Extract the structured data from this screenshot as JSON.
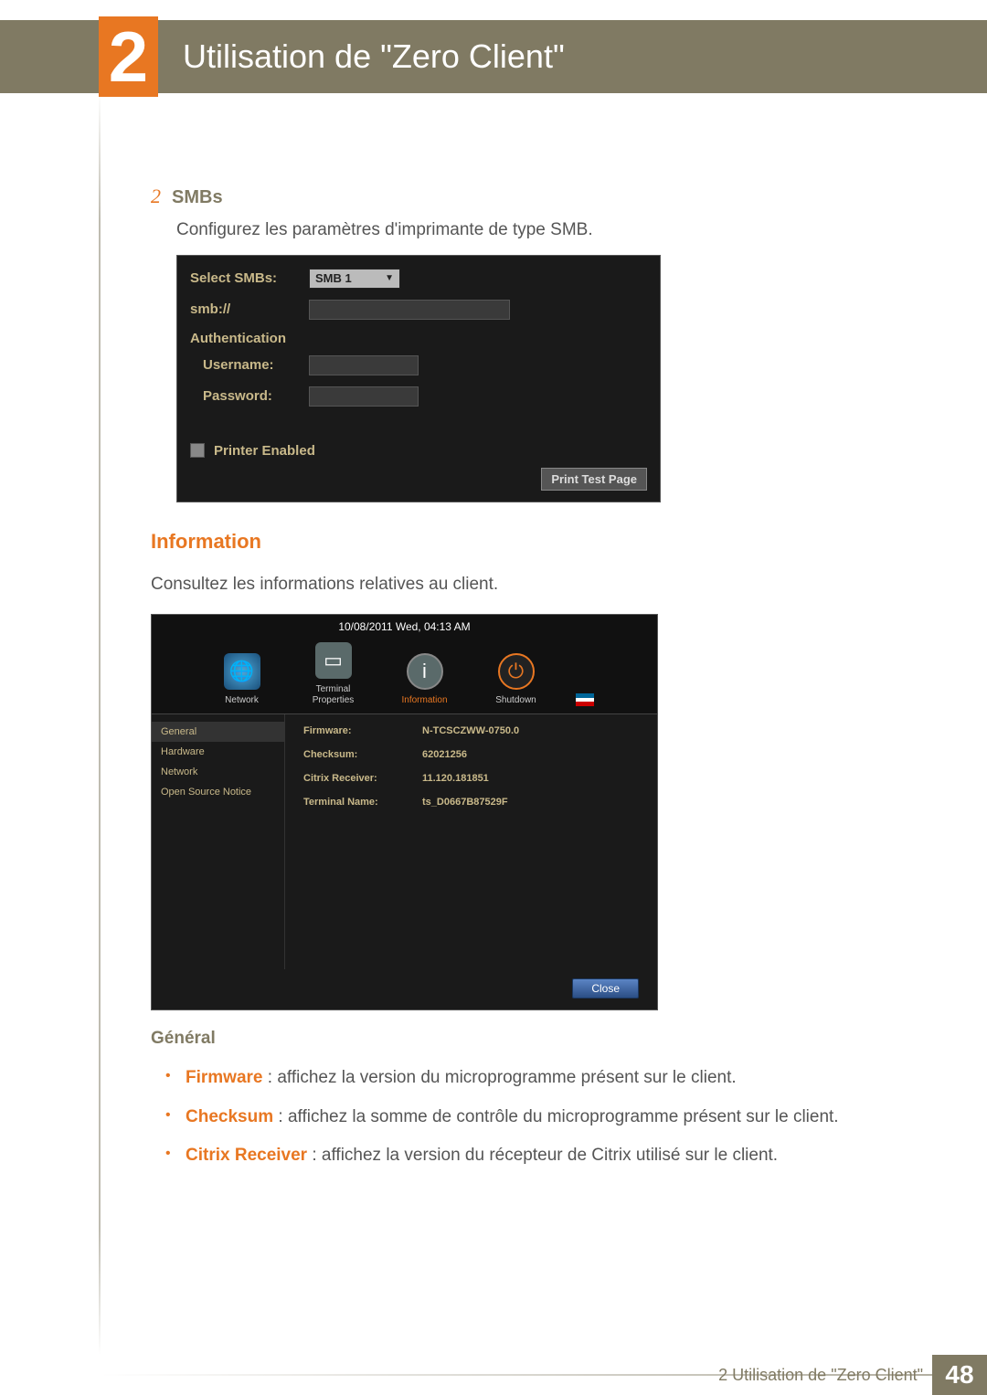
{
  "header": {
    "chapter_number": "2",
    "chapter_title": "Utilisation de \"Zero Client\""
  },
  "step": {
    "number": "2",
    "title": "SMBs",
    "description": "Configurez les paramètres d'imprimante de type SMB."
  },
  "smb_panel": {
    "select_label": "Select SMBs:",
    "select_value": "SMB 1",
    "url_label": "smb://",
    "auth_label": "Authentication",
    "username_label": "Username:",
    "password_label": "Password:",
    "printer_enabled_label": "Printer Enabled",
    "print_button": "Print Test Page"
  },
  "information_section": {
    "heading": "Information",
    "intro": "Consultez les informations relatives au client."
  },
  "info_shot": {
    "datetime": "10/08/2011 Wed, 04:13 AM",
    "launcher": {
      "network": "Network",
      "terminal": "Terminal Properties",
      "information": "Information",
      "shutdown": "Shutdown"
    },
    "sidebar": [
      "General",
      "Hardware",
      "Network",
      "Open Source Notice"
    ],
    "rows": [
      {
        "k": "Firmware:",
        "v": "N-TCSCZWW-0750.0"
      },
      {
        "k": "Checksum:",
        "v": "62021256"
      },
      {
        "k": "Citrix Receiver:",
        "v": "11.120.181851"
      },
      {
        "k": "Terminal Name:",
        "v": "ts_D0667B87529F"
      }
    ],
    "close": "Close"
  },
  "general_block": {
    "heading": "Général",
    "items": [
      {
        "term": "Firmware",
        "desc": " : affichez la version du microprogramme présent sur le client."
      },
      {
        "term": "Checksum",
        "desc": " : affichez la somme de contrôle du microprogramme présent sur le client."
      },
      {
        "term": "Citrix Receiver",
        "desc": " : affichez la version du récepteur de Citrix utilisé sur le client."
      }
    ]
  },
  "footer": {
    "text": "2 Utilisation de \"Zero Client\"",
    "page": "48"
  }
}
